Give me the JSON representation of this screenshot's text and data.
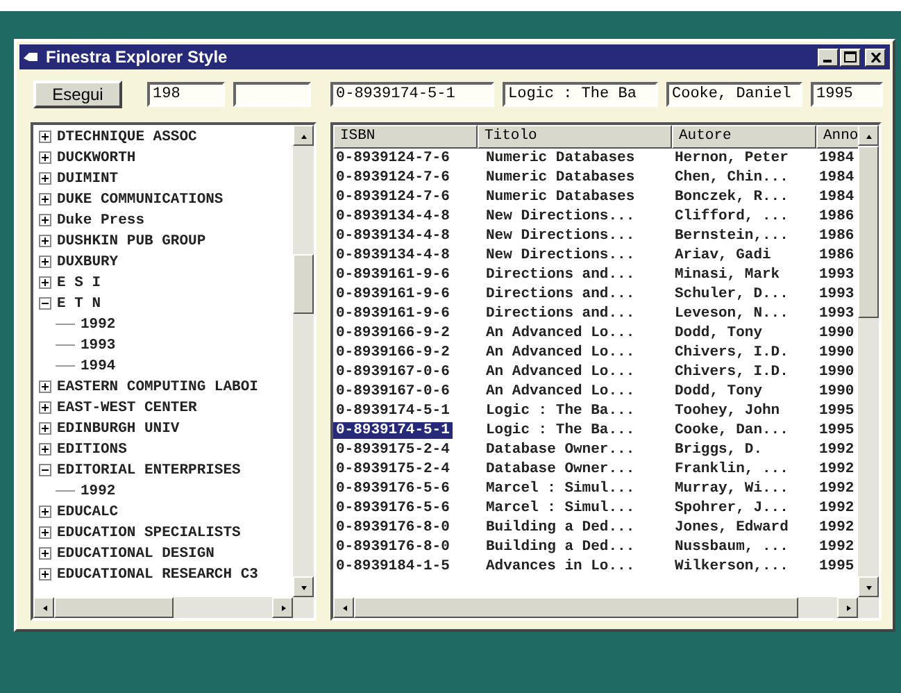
{
  "window": {
    "title": "Finestra Explorer Style"
  },
  "toolbar": {
    "button": "Esegui",
    "fields": [
      {
        "kind": "text",
        "value": "198"
      },
      {
        "kind": "blank"
      },
      {
        "kind": "text",
        "value": "0-8939174-5-1"
      },
      {
        "kind": "text",
        "value": "Logic : The Ba"
      },
      {
        "kind": "text",
        "value": "Cooke, Daniel"
      },
      {
        "kind": "text",
        "value": "1995"
      }
    ]
  },
  "tree": {
    "items": [
      {
        "label": "DTECHNIQUE ASSOC",
        "expanded": false
      },
      {
        "label": "DUCKWORTH",
        "expanded": false
      },
      {
        "label": "DUIMINT",
        "expanded": false
      },
      {
        "label": "DUKE COMMUNICATIONS",
        "expanded": false
      },
      {
        "label": "Duke Press",
        "expanded": false
      },
      {
        "label": "DUSHKIN PUB GROUP",
        "expanded": false
      },
      {
        "label": "DUXBURY",
        "expanded": false
      },
      {
        "label": "E S I",
        "expanded": false
      },
      {
        "label": "E T N",
        "expanded": true,
        "children": [
          {
            "label": "1992"
          },
          {
            "label": "1993"
          },
          {
            "label": "1994"
          }
        ]
      },
      {
        "label": "EASTERN COMPUTING LABOI",
        "expanded": false
      },
      {
        "label": "EAST-WEST CENTER",
        "expanded": false
      },
      {
        "label": "EDINBURGH UNIV",
        "expanded": false
      },
      {
        "label": "EDITIONS",
        "expanded": false
      },
      {
        "label": "EDITORIAL ENTERPRISES",
        "expanded": true,
        "children": [
          {
            "label": "1992"
          }
        ]
      },
      {
        "label": "EDUCALC",
        "expanded": false
      },
      {
        "label": "EDUCATION SPECIALISTS",
        "expanded": false
      },
      {
        "label": "EDUCATIONAL DESIGN",
        "expanded": false
      },
      {
        "label": "EDUCATIONAL RESEARCH C3",
        "expanded": false
      }
    ]
  },
  "table": {
    "columns": [
      "ISBN",
      "Titolo",
      "Autore",
      "Anno"
    ],
    "rows": [
      {
        "cells": [
          "0-8939124-7-6",
          "Numeric Databases",
          "Hernon, Peter",
          "1984"
        ],
        "selected": false
      },
      {
        "cells": [
          "0-8939124-7-6",
          "Numeric Databases",
          "Chen, Chin...",
          "1984"
        ],
        "selected": false
      },
      {
        "cells": [
          "0-8939124-7-6",
          "Numeric Databases",
          "Bonczek, R...",
          "1984"
        ],
        "selected": false
      },
      {
        "cells": [
          "0-8939134-4-8",
          "New Directions...",
          "Clifford, ...",
          "1986"
        ],
        "selected": false
      },
      {
        "cells": [
          "0-8939134-4-8",
          "New Directions...",
          "Bernstein,...",
          "1986"
        ],
        "selected": false
      },
      {
        "cells": [
          "0-8939134-4-8",
          "New Directions...",
          "Ariav, Gadi",
          "1986"
        ],
        "selected": false
      },
      {
        "cells": [
          "0-8939161-9-6",
          "Directions and...",
          "Minasi, Mark",
          "1993"
        ],
        "selected": false
      },
      {
        "cells": [
          "0-8939161-9-6",
          "Directions and...",
          "Schuler, D...",
          "1993"
        ],
        "selected": false
      },
      {
        "cells": [
          "0-8939161-9-6",
          "Directions and...",
          "Leveson, N...",
          "1993"
        ],
        "selected": false
      },
      {
        "cells": [
          "0-8939166-9-2",
          "An Advanced Lo...",
          "Dodd, Tony",
          "1990"
        ],
        "selected": false
      },
      {
        "cells": [
          "0-8939166-9-2",
          "An Advanced Lo...",
          "Chivers, I.D.",
          "1990"
        ],
        "selected": false
      },
      {
        "cells": [
          "0-8939167-0-6",
          "An Advanced Lo...",
          "Chivers, I.D.",
          "1990"
        ],
        "selected": false
      },
      {
        "cells": [
          "0-8939167-0-6",
          "An Advanced Lo...",
          "Dodd, Tony",
          "1990"
        ],
        "selected": false
      },
      {
        "cells": [
          "0-8939174-5-1",
          "Logic : The Ba...",
          "Toohey, John",
          "1995"
        ],
        "selected": false
      },
      {
        "cells": [
          "0-8939174-5-1",
          "Logic : The Ba...",
          "Cooke, Dan...",
          "1995"
        ],
        "selected": true
      },
      {
        "cells": [
          "0-8939175-2-4",
          "Database Owner...",
          "Briggs, D.",
          "1992"
        ],
        "selected": false
      },
      {
        "cells": [
          "0-8939175-2-4",
          "Database Owner...",
          "Franklin, ...",
          "1992"
        ],
        "selected": false
      },
      {
        "cells": [
          "0-8939176-5-6",
          "Marcel : Simul...",
          "Murray, Wi...",
          "1992"
        ],
        "selected": false
      },
      {
        "cells": [
          "0-8939176-5-6",
          "Marcel : Simul...",
          "Spohrer, J...",
          "1992"
        ],
        "selected": false
      },
      {
        "cells": [
          "0-8939176-8-0",
          "Building a Ded...",
          "Jones, Edward",
          "1992"
        ],
        "selected": false
      },
      {
        "cells": [
          "0-8939176-8-0",
          "Building a Ded...",
          "Nussbaum, ...",
          "1992"
        ],
        "selected": false
      },
      {
        "cells": [
          "0-8939184-1-5",
          "Advances in Lo...",
          "Wilkerson,...",
          "1995"
        ],
        "selected": false
      }
    ]
  }
}
